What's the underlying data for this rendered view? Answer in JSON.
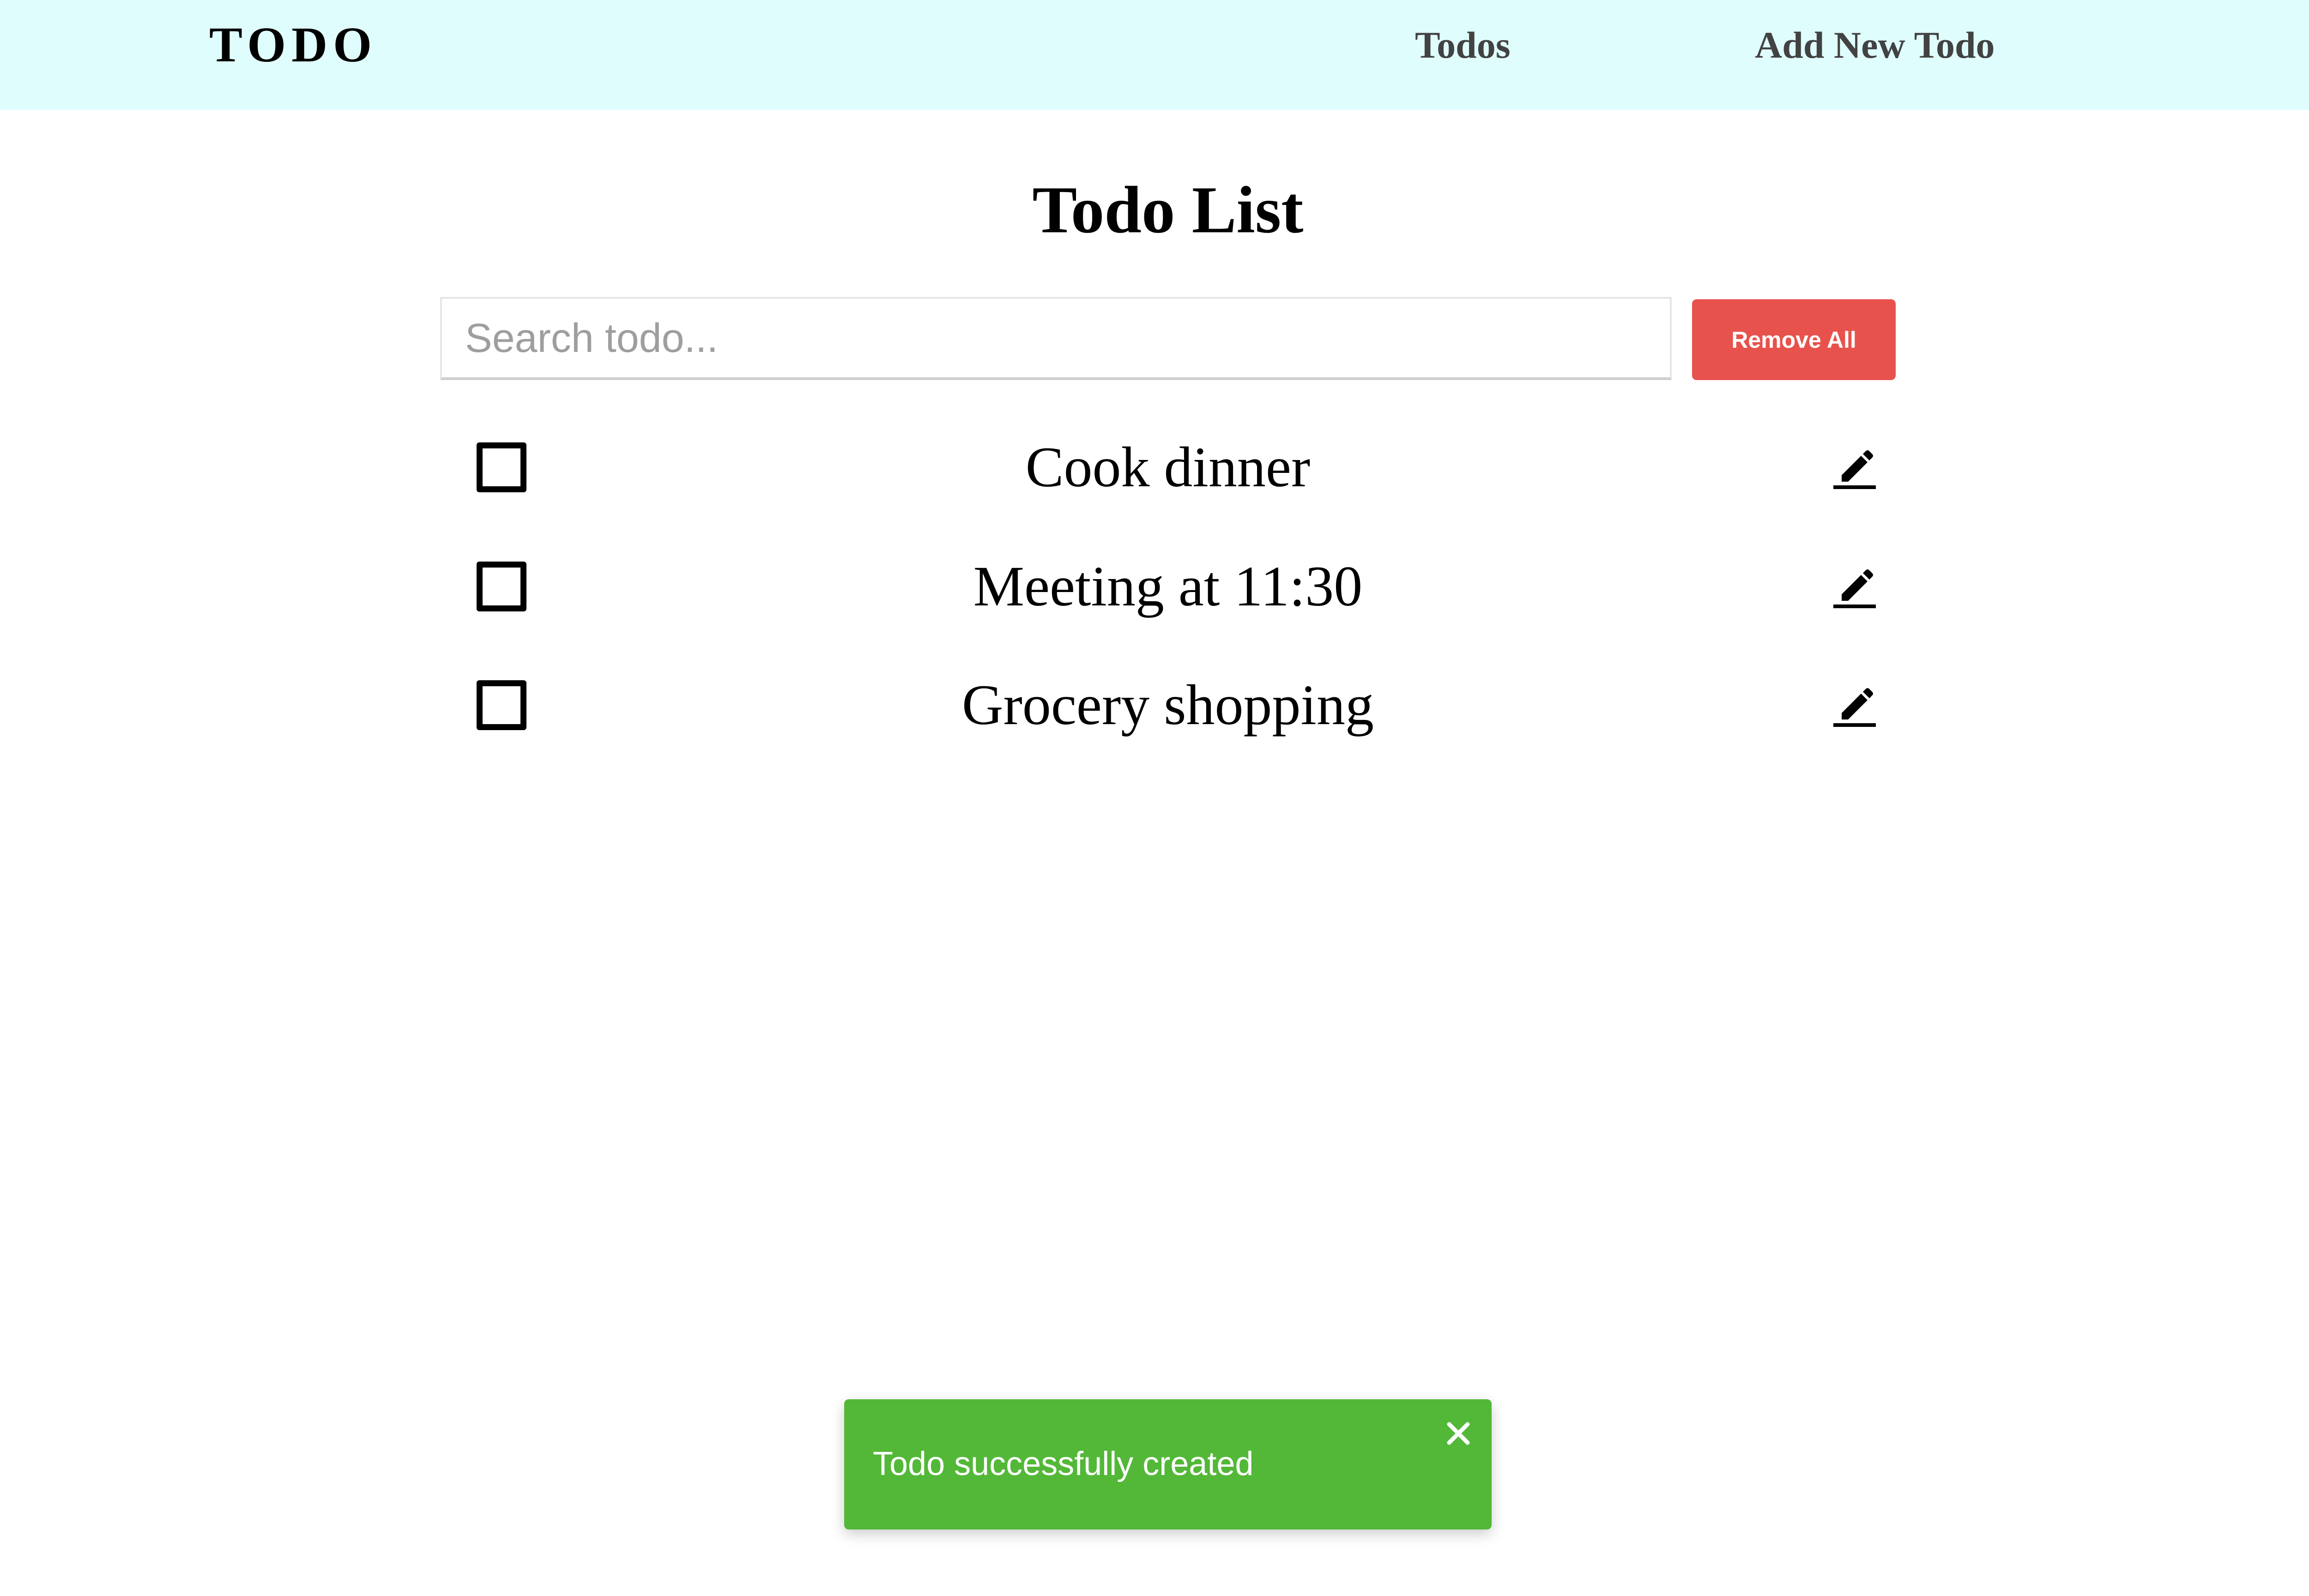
{
  "navbar": {
    "brand": "TODO",
    "links": [
      {
        "label": "Todos"
      },
      {
        "label": "Add New Todo"
      }
    ]
  },
  "main": {
    "title": "Todo List",
    "search": {
      "placeholder": "Search todo...",
      "value": ""
    },
    "remove_all_label": "Remove All",
    "todos": [
      {
        "text": "Cook dinner",
        "completed": false
      },
      {
        "text": "Meeting at 11:30",
        "completed": false
      },
      {
        "text": "Grocery shopping",
        "completed": false
      }
    ]
  },
  "toast": {
    "message": "Todo successfully created",
    "icon": "close-icon"
  },
  "colors": {
    "navbar_bg": "#e0fdfd",
    "danger": "#e8524c",
    "success": "#53b838"
  }
}
